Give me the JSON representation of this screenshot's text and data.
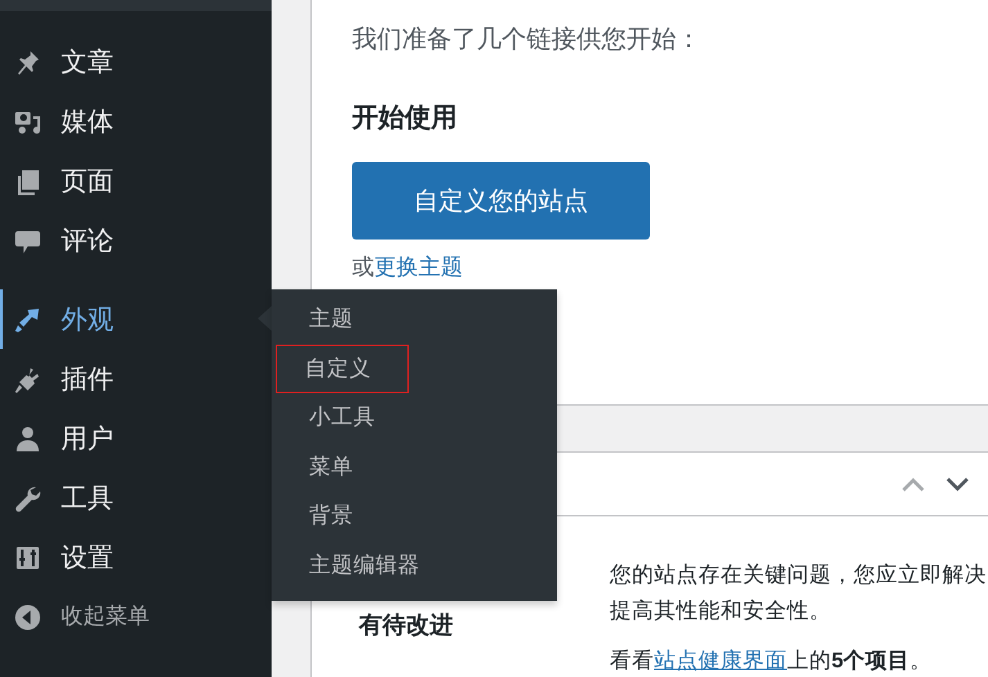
{
  "sidebar": {
    "groups": [
      [
        {
          "label": "文章",
          "selected": false
        },
        {
          "label": "媒体",
          "selected": false
        },
        {
          "label": "页面",
          "selected": false
        },
        {
          "label": "评论",
          "selected": false
        }
      ],
      [
        {
          "label": "外观",
          "selected": true
        },
        {
          "label": "插件",
          "selected": false
        },
        {
          "label": "用户",
          "selected": false
        },
        {
          "label": "工具",
          "selected": false
        },
        {
          "label": "设置",
          "selected": false
        }
      ]
    ],
    "collapse": "收起菜单"
  },
  "flyout": {
    "items": [
      {
        "label": "主题",
        "highlighted": false
      },
      {
        "label": "自定义",
        "highlighted": true
      },
      {
        "label": "小工具",
        "highlighted": false
      },
      {
        "label": "菜单",
        "highlighted": false
      },
      {
        "label": "背景",
        "highlighted": false
      },
      {
        "label": "主题编辑器",
        "highlighted": false
      }
    ]
  },
  "welcome": {
    "subtitle": "我们准备了几个链接供您开始：",
    "heading": "开始使用",
    "button": "自定义您的站点",
    "alt_prefix": "或",
    "alt_link": "更换主题"
  },
  "health": {
    "status": "有待改进",
    "lines": [
      "您的站点存在关键问题，您应立即解决",
      "提高其性能和安全性。"
    ],
    "more": [
      {
        "kind": "text",
        "text": "看看"
      },
      {
        "kind": "link",
        "text": "站点健康界面"
      },
      {
        "kind": "text",
        "text": "上的**5个项目**。"
      }
    ]
  }
}
